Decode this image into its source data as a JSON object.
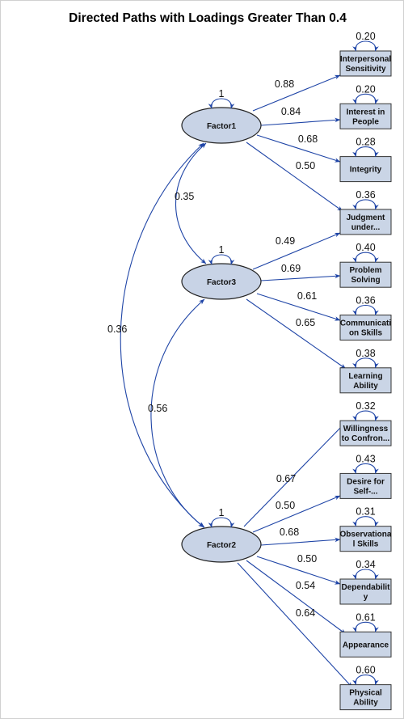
{
  "title": "Directed Paths with Loadings Greater Than 0.4",
  "colors": {
    "path": "#1e44a6",
    "node_fill": "#cad5e6",
    "node_stroke": "#333333",
    "factor_fill": "#c8d3e6"
  },
  "factors": [
    {
      "id": "F1",
      "label": "Factor1",
      "variance": "1"
    },
    {
      "id": "F3",
      "label": "Factor3",
      "variance": "1"
    },
    {
      "id": "F2",
      "label": "Factor2",
      "variance": "1"
    }
  ],
  "indicators": [
    {
      "label": [
        "Interpersonal",
        "Sensitivity"
      ],
      "error_variance": "0.20"
    },
    {
      "label": [
        "Interest in",
        "People"
      ],
      "error_variance": "0.20"
    },
    {
      "label": [
        "Integrity"
      ],
      "error_variance": "0.28"
    },
    {
      "label": [
        "Judgment",
        "under..."
      ],
      "error_variance": "0.36"
    },
    {
      "label": [
        "Problem",
        "Solving"
      ],
      "error_variance": "0.40"
    },
    {
      "label": [
        "Communicati",
        "on Skills"
      ],
      "error_variance": "0.36"
    },
    {
      "label": [
        "Learning",
        "Ability"
      ],
      "error_variance": "0.38"
    },
    {
      "label": [
        "Willingness",
        "to Confron..."
      ],
      "error_variance": "0.32"
    },
    {
      "label": [
        "Desire for",
        "Self-..."
      ],
      "error_variance": "0.43"
    },
    {
      "label": [
        "Observationa",
        "l Skills"
      ],
      "error_variance": "0.31"
    },
    {
      "label": [
        "Dependabilit",
        "y"
      ],
      "error_variance": "0.34"
    },
    {
      "label": [
        "Appearance"
      ],
      "error_variance": "0.61"
    },
    {
      "label": [
        "Physical",
        "Ability"
      ],
      "error_variance": "0.60"
    }
  ],
  "loadings": [
    {
      "from": 0,
      "to": 0,
      "value": "0.88"
    },
    {
      "from": 0,
      "to": 1,
      "value": "0.84"
    },
    {
      "from": 0,
      "to": 2,
      "value": "0.68"
    },
    {
      "from": 0,
      "to": 3,
      "value": "0.50"
    },
    {
      "from": 1,
      "to": 3,
      "value": "0.49"
    },
    {
      "from": 1,
      "to": 4,
      "value": "0.69"
    },
    {
      "from": 1,
      "to": 5,
      "value": "0.61"
    },
    {
      "from": 1,
      "to": 6,
      "value": "0.65"
    },
    {
      "from": 2,
      "to": 7,
      "value": "0.67"
    },
    {
      "from": 2,
      "to": 8,
      "value": "0.50"
    },
    {
      "from": 2,
      "to": 9,
      "value": "0.68"
    },
    {
      "from": 2,
      "to": 10,
      "value": "0.50"
    },
    {
      "from": 2,
      "to": 11,
      "value": "0.54"
    },
    {
      "from": 2,
      "to": 12,
      "value": "0.64"
    }
  ],
  "covariances": [
    {
      "a": 0,
      "b": 1,
      "value": "0.35"
    },
    {
      "a": 1,
      "b": 2,
      "value": "0.56"
    },
    {
      "a": 0,
      "b": 2,
      "value": "0.36"
    }
  ]
}
